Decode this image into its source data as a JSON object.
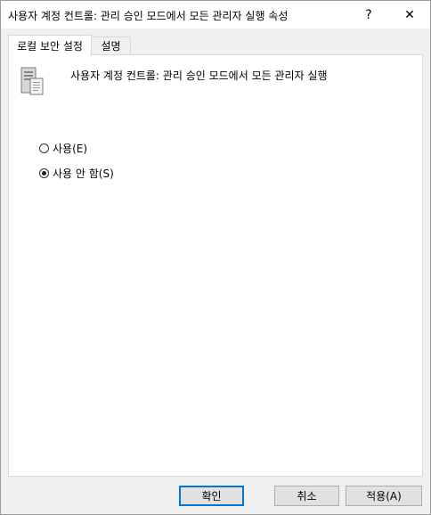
{
  "window": {
    "title": "사용자 계정 컨트롤: 관리 승인 모드에서 모든 관리자 실행 속성",
    "help_label": "?",
    "close_label": "✕"
  },
  "tabs": [
    {
      "label": "로컬 보안 설정",
      "selected": true
    },
    {
      "label": "설명",
      "selected": false
    }
  ],
  "policy": {
    "name": "사용자 계정 컨트롤: 관리 승인 모드에서 모든 관리자 실행",
    "icon": "server-policy-icon"
  },
  "options": [
    {
      "label": "사용(E)",
      "checked": false
    },
    {
      "label": "사용 안 함(S)",
      "checked": true
    }
  ],
  "buttons": {
    "ok": "확인",
    "cancel": "취소",
    "apply": "적용(A)"
  },
  "colors": {
    "focus_border": "#0078d7",
    "button_bg": "#e1e1e1"
  }
}
